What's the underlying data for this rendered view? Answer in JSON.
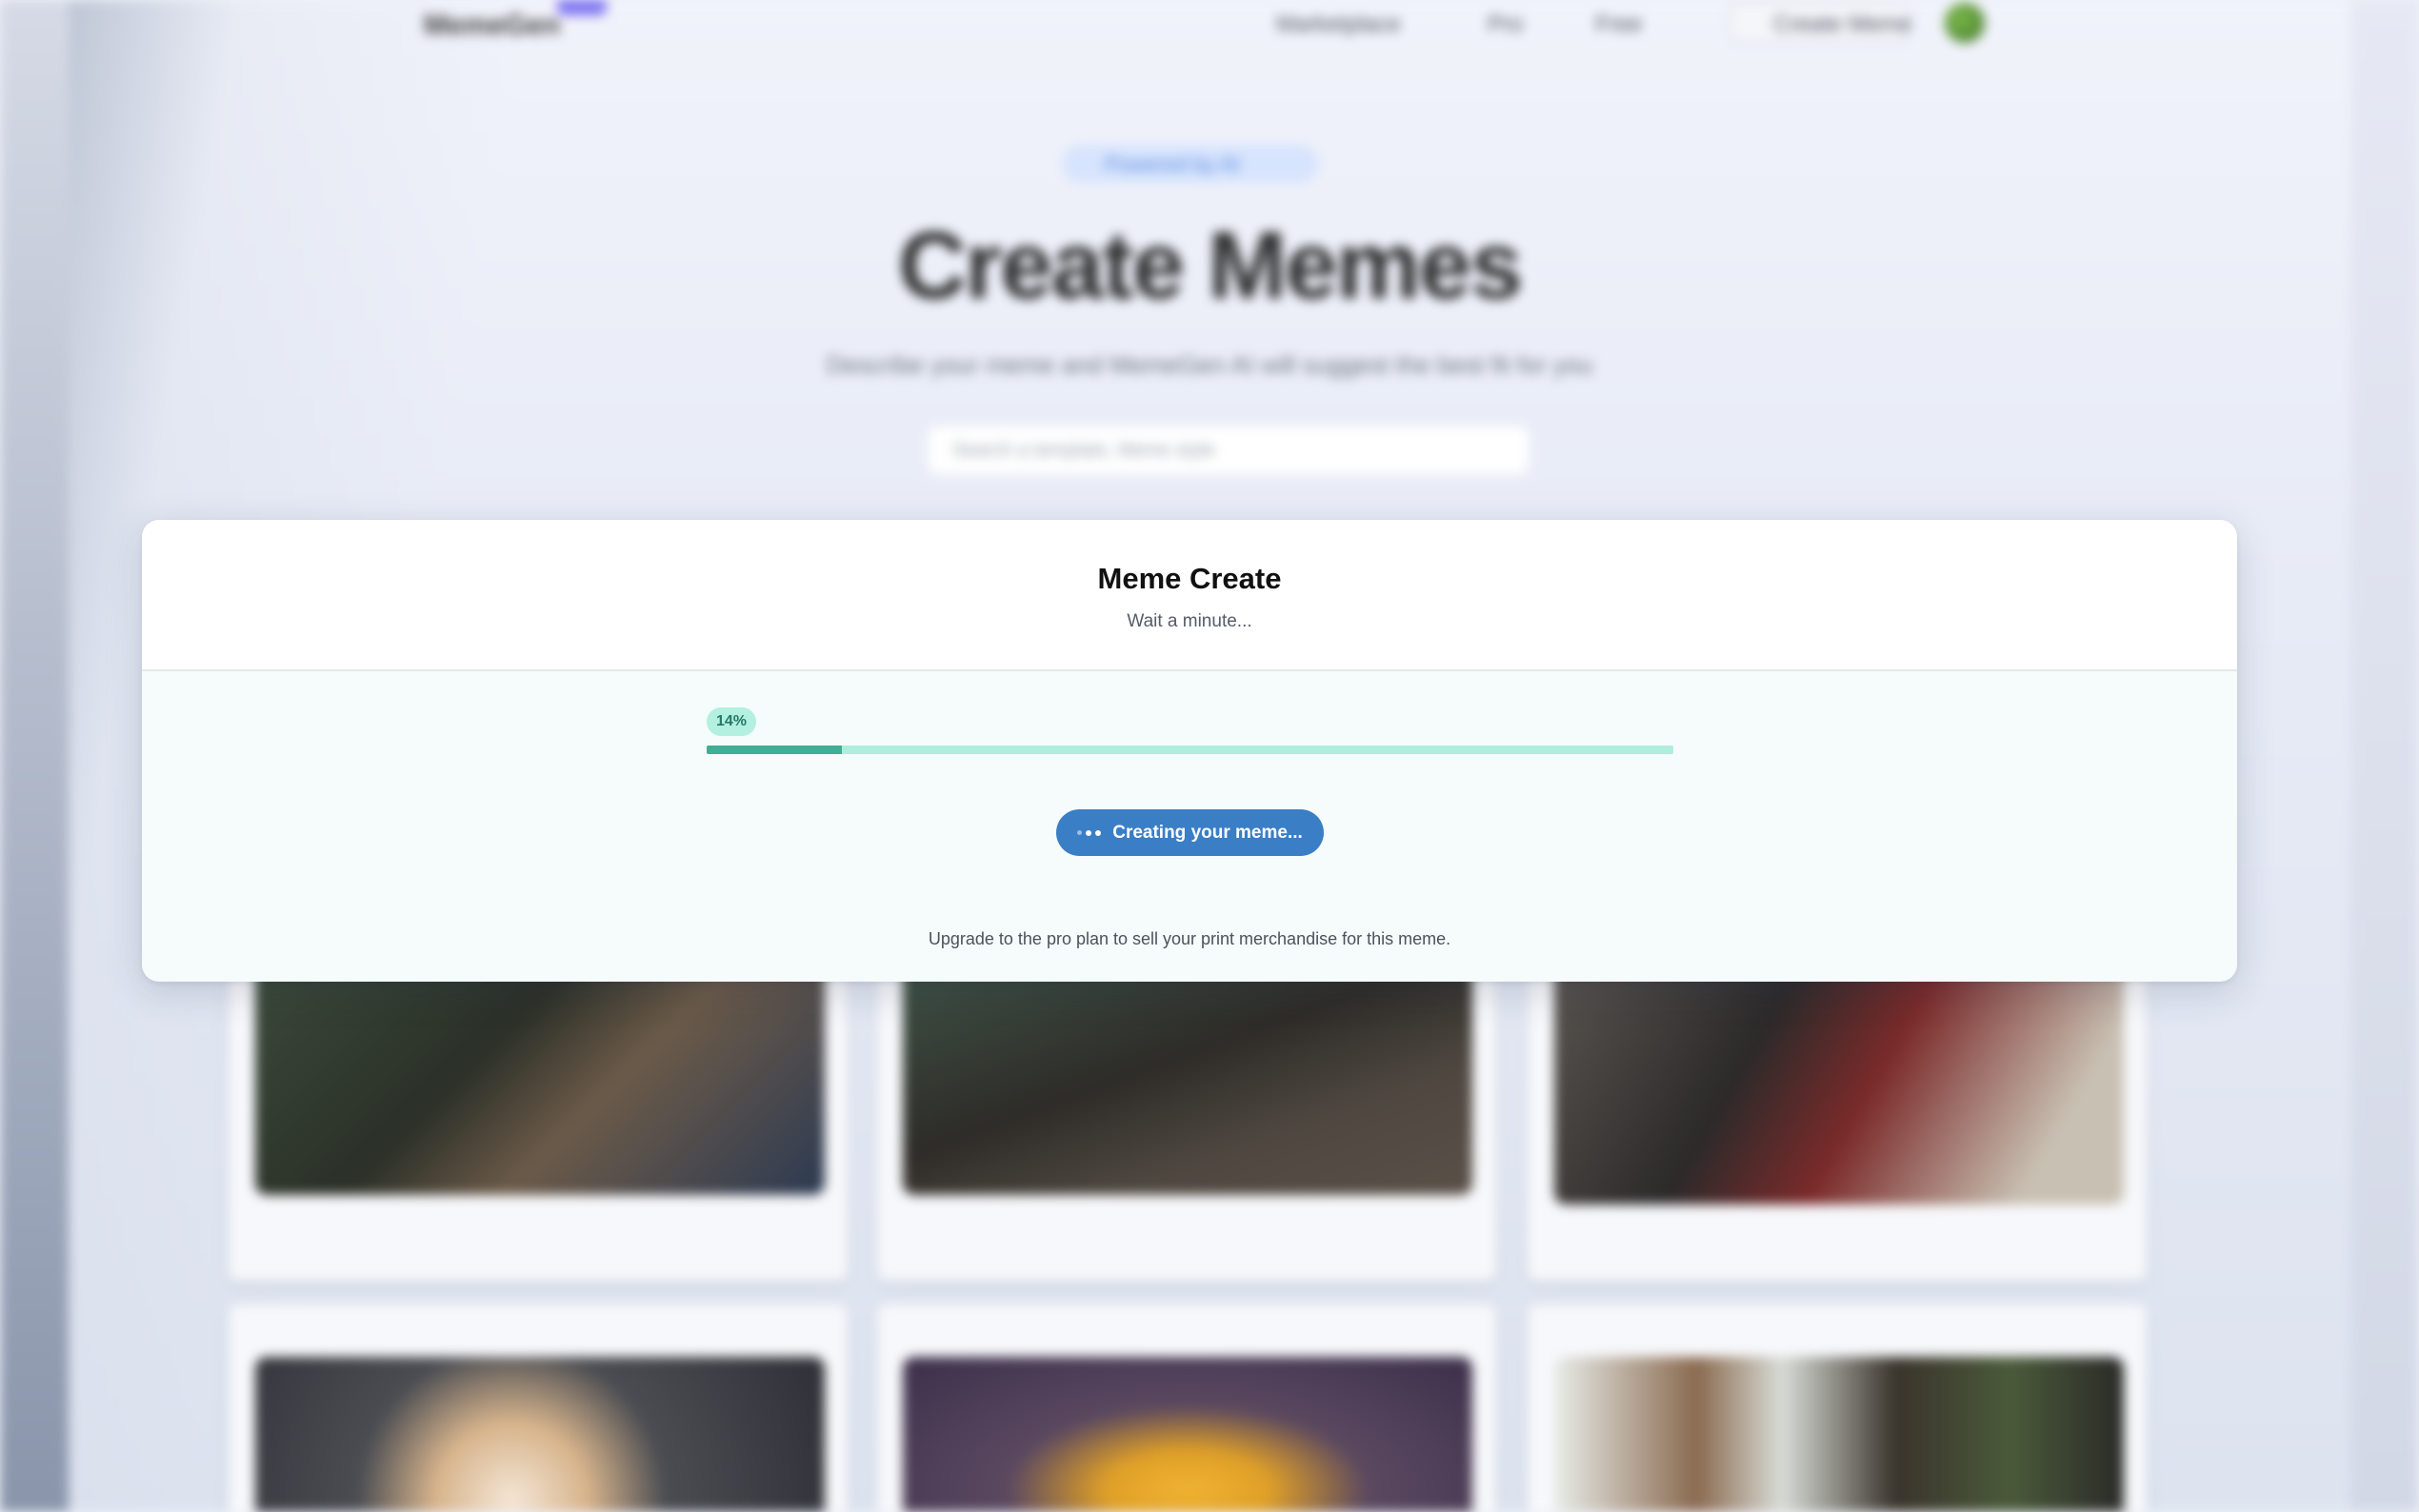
{
  "background": {
    "brand": "MemeGen",
    "nav": [
      "Marketplace",
      "Pro",
      "Free",
      "Create Meme"
    ],
    "badge": "Powered by AI",
    "title": "Create Memes",
    "subtitle": "Describe your meme and MemeGen AI will suggest the best fit for you",
    "search_placeholder": "Search a template, Meme style"
  },
  "modal": {
    "title": "Meme Create",
    "subtitle": "Wait a minute...",
    "progress": {
      "percent_label": "14%",
      "value": 0.14,
      "track_color": "#aeeedd",
      "fill_color": "#3fae95"
    },
    "button_label": "Creating your meme...",
    "button_color": "#3a7ec6",
    "footer_text": "Upgrade to the pro plan to sell your print merchandise for this meme."
  }
}
